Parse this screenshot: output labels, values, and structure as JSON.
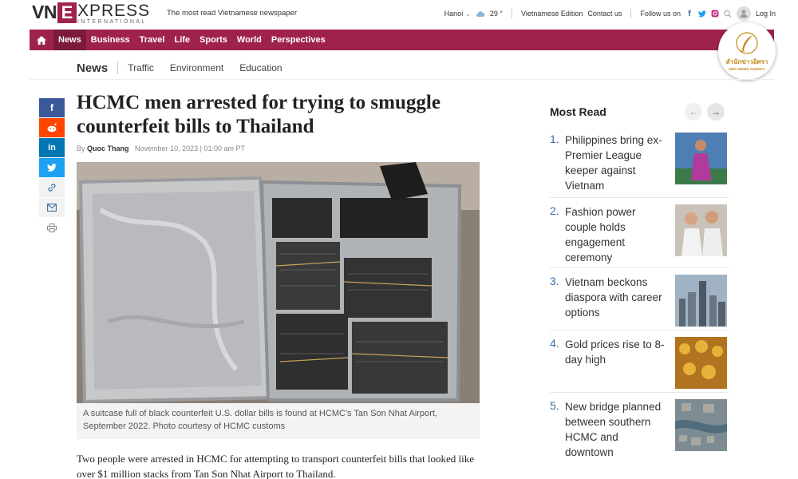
{
  "header": {
    "logo_vn": "VN",
    "logo_e": "E",
    "logo_xpress": "XPRESS",
    "logo_international": "INTERNATIONAL",
    "tagline": "The most read Vietnamese newspaper",
    "city": "Hanoi",
    "temperature": "29 °",
    "edition": "Vietnamese Edition",
    "contact": "Contact us",
    "follow": "Follow us on",
    "login": "Log In"
  },
  "nav": {
    "items": [
      "News",
      "Business",
      "Travel",
      "Life",
      "Sports",
      "World",
      "Perspectives"
    ],
    "active": "News"
  },
  "badge": {
    "line1": "สำนักข่าวอิศรา",
    "line2": "ISRA NEWS AGENCY"
  },
  "subnav": {
    "current": "News",
    "links": [
      "Traffic",
      "Environment",
      "Education"
    ]
  },
  "share": {
    "icons": [
      "facebook-icon",
      "reddit-icon",
      "linkedin-icon",
      "twitter-icon",
      "link-icon",
      "email-icon",
      "print-icon"
    ]
  },
  "article": {
    "title": "HCMC men arrested for trying to smuggle counterfeit bills to Thailand",
    "by": "By",
    "author": "Quoc Thang",
    "date": "November 10, 2023 | 01:00 am PT",
    "caption": "A suitcase full of black counterfeit U.S. dollar bills is found at HCMC's Tan Son Nhat Airport, September 2022. Photo courtesy of HCMC customs",
    "lead": "Two people were arrested in HCMC for attempting to transport counterfeit bills that looked like over $1 million stacks from Tan Son Nhat Airport to Thailand."
  },
  "most_read": {
    "title": "Most Read",
    "items": [
      {
        "num": "1.",
        "text": "Philippines bring ex-Premier League keeper against Vietnam"
      },
      {
        "num": "2.",
        "text": "Fashion power couple holds engagement ceremony"
      },
      {
        "num": "3.",
        "text": "Vietnam beckons diaspora with career options"
      },
      {
        "num": "4.",
        "text": "Gold prices rise to 8-day high"
      },
      {
        "num": "5.",
        "text": "New bridge planned between southern HCMC and downtown"
      }
    ]
  },
  "colors": {
    "brand": "#9f224e",
    "brand_dark": "#7b1a3b",
    "link_blue": "#3a6ea5"
  }
}
